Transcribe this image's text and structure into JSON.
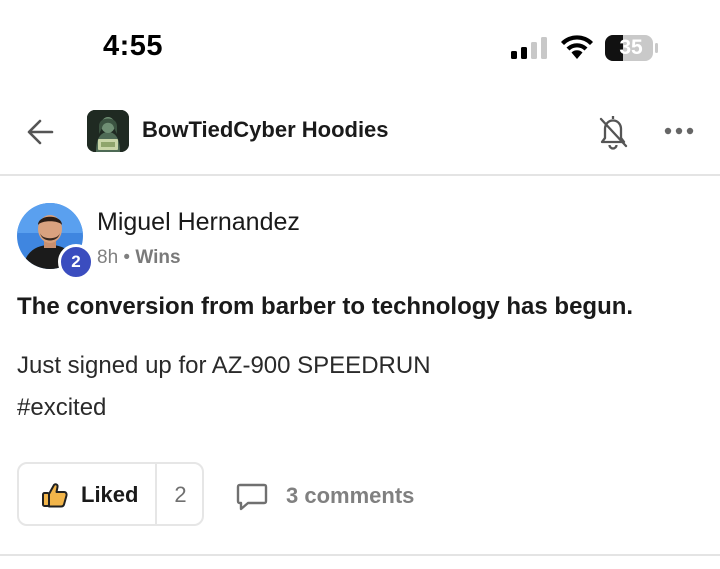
{
  "status_bar": {
    "time": "4:55",
    "battery": "35"
  },
  "header": {
    "group_name": "BowTiedCyber Hoodies"
  },
  "post": {
    "author": "Miguel Hernandez",
    "level": "2",
    "time_ago": "8h",
    "separator": "•",
    "category": "Wins",
    "title": "The conversion from barber to technology has begun.",
    "body_line1": "Just signed up for AZ-900 SPEEDRUN",
    "body_line2": "#excited"
  },
  "actions": {
    "like_label": "Liked",
    "like_count": "2",
    "comments_label": "3 comments"
  },
  "colors": {
    "level_badge": "#3b4dbf",
    "like_icon": "#e8a23a"
  }
}
